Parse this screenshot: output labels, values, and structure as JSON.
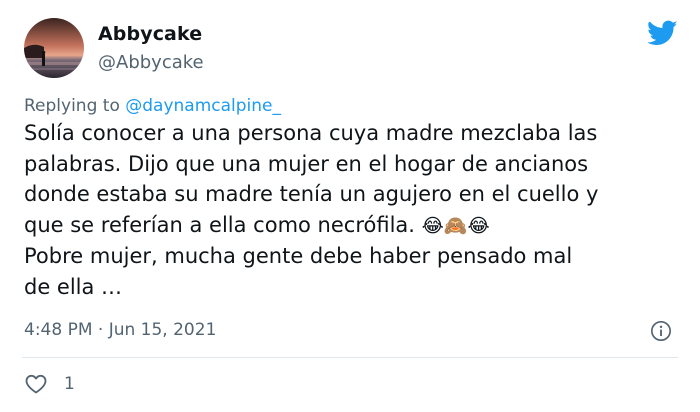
{
  "author": {
    "display_name": "Abbycake",
    "handle": "@Abbycake"
  },
  "reply": {
    "prefix": "Replying to ",
    "mention": "@daynamcalpine_"
  },
  "tweet": {
    "lines": [
      "Solía conocer a una persona cuya madre mezclaba las",
      "palabras. Dijo que una mujer en el hogar de ancianos",
      "donde estaba su madre tenía un agujero en el cuello y",
      "que se referían a ella como necrófila.",
      "Pobre mujer, mucha gente debe haber pensado mal",
      "de ella …"
    ],
    "emojis": [
      "😂",
      "🙈",
      "😂"
    ]
  },
  "meta": {
    "timestamp": "4:48 PM · Jun 15, 2021"
  },
  "stats": {
    "likes": "1"
  },
  "colors": {
    "brand": "#1d9bf0",
    "secondary_text": "#536471"
  },
  "icons": {
    "platform": "twitter-bird-icon",
    "info": "info-icon",
    "like": "heart-icon"
  }
}
